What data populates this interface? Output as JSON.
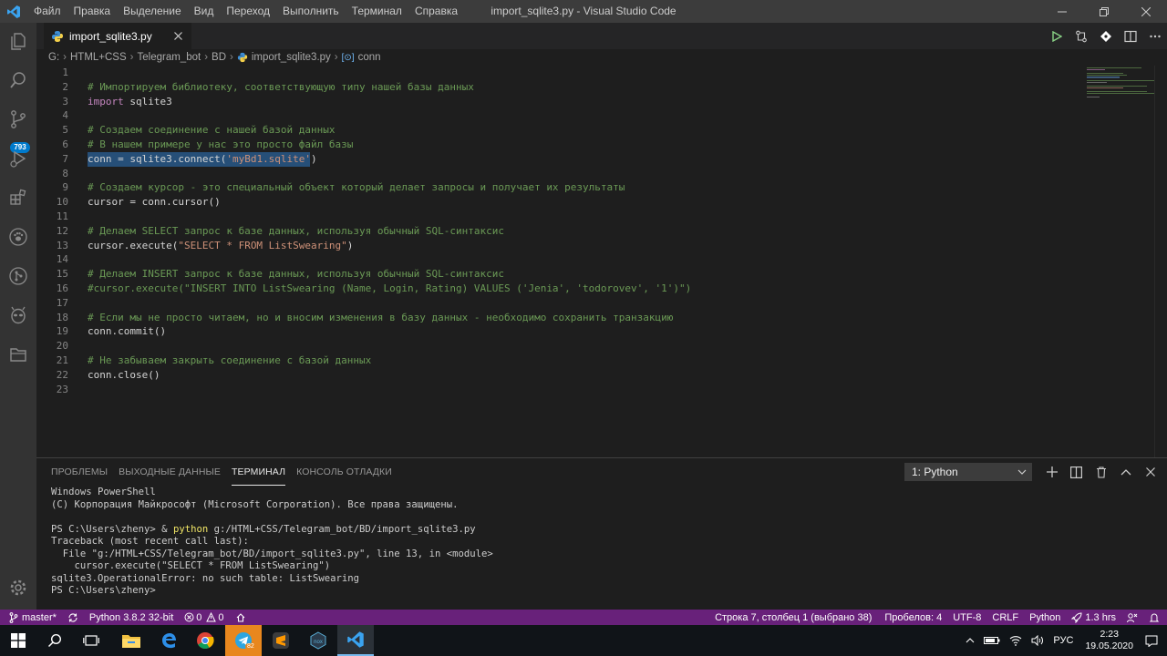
{
  "titlebar": {
    "menu": [
      "Файл",
      "Правка",
      "Выделение",
      "Вид",
      "Переход",
      "Выполнить",
      "Терминал",
      "Справка"
    ],
    "window_title": "import_sqlite3.py - Visual Studio Code"
  },
  "activitybar": {
    "scm_badge": "793"
  },
  "tab": {
    "label": "import_sqlite3.py"
  },
  "breadcrumb": {
    "items": [
      "G:",
      "HTML+CSS",
      "Telegram_bot",
      "BD",
      "import_sqlite3.py",
      "conn"
    ]
  },
  "editor": {
    "lines": [
      {
        "n": "1",
        "parts": []
      },
      {
        "n": "2",
        "parts": [
          {
            "t": "# Импортируем библиотеку, соответствующую типу нашей базы данных",
            "c": "c-comment"
          }
        ]
      },
      {
        "n": "3",
        "parts": [
          {
            "t": "import",
            "c": "c-kw"
          },
          {
            "t": " sqlite3",
            "c": "c-plain"
          }
        ]
      },
      {
        "n": "4",
        "parts": []
      },
      {
        "n": "5",
        "parts": [
          {
            "t": "# Создаем соединение с нашей базой данных",
            "c": "c-comment"
          }
        ]
      },
      {
        "n": "6",
        "parts": [
          {
            "t": "# В нашем примере у нас это просто файл базы",
            "c": "c-comment"
          }
        ]
      },
      {
        "n": "7",
        "parts": [
          {
            "t": "conn = sqlite3.connect(",
            "c": "c-plain"
          },
          {
            "t": "'myBd1.sqlite'",
            "c": "c-str"
          },
          {
            "t": ")",
            "c": "c-plain"
          }
        ]
      },
      {
        "n": "8",
        "parts": []
      },
      {
        "n": "9",
        "parts": [
          {
            "t": "# Создаем курсор - это специальный объект который делает запросы и получает их результаты",
            "c": "c-comment"
          }
        ]
      },
      {
        "n": "10",
        "parts": [
          {
            "t": "cursor = conn.cursor()",
            "c": "c-plain"
          }
        ]
      },
      {
        "n": "11",
        "parts": []
      },
      {
        "n": "12",
        "parts": [
          {
            "t": "# Делаем SELECT запрос к базе данных, используя обычный SQL-синтаксис",
            "c": "c-comment"
          }
        ]
      },
      {
        "n": "13",
        "parts": [
          {
            "t": "cursor.execute(",
            "c": "c-plain"
          },
          {
            "t": "\"SELECT * FROM ListSwearing\"",
            "c": "c-str"
          },
          {
            "t": ")",
            "c": "c-plain"
          }
        ]
      },
      {
        "n": "14",
        "parts": []
      },
      {
        "n": "15",
        "parts": [
          {
            "t": "# Делаем INSERT запрос к базе данных, используя обычный SQL-синтаксис",
            "c": "c-comment"
          }
        ]
      },
      {
        "n": "16",
        "parts": [
          {
            "t": "#cursor.execute(\"INSERT INTO ListSwearing (Name, Login, Rating) VALUES ('Jenia', 'todorovev', '1')\")",
            "c": "c-comment"
          }
        ]
      },
      {
        "n": "17",
        "parts": []
      },
      {
        "n": "18",
        "parts": [
          {
            "t": "# Если мы не просто читаем, но и вносим изменения в базу данных - необходимо сохранить транзакцию",
            "c": "c-comment"
          }
        ]
      },
      {
        "n": "19",
        "parts": [
          {
            "t": "conn.commit()",
            "c": "c-plain"
          }
        ]
      },
      {
        "n": "20",
        "parts": []
      },
      {
        "n": "21",
        "parts": [
          {
            "t": "# Не забываем закрыть соединение с базой данных",
            "c": "c-comment"
          }
        ]
      },
      {
        "n": "22",
        "parts": [
          {
            "t": "conn.close()",
            "c": "c-plain"
          }
        ]
      },
      {
        "n": "23",
        "parts": []
      }
    ]
  },
  "panel": {
    "tabs": [
      "ПРОБЛЕМЫ",
      "ВЫХОДНЫЕ ДАННЫЕ",
      "ТЕРМИНАЛ",
      "КОНСОЛЬ ОТЛАДКИ"
    ],
    "terminal_select": "1: Python",
    "terminal_lines": [
      [
        {
          "t": "Windows PowerShell",
          "c": ""
        }
      ],
      [
        {
          "t": "(C) Корпорация Майкрософт (Microsoft Corporation). Все права защищены.",
          "c": ""
        }
      ],
      [],
      [
        {
          "t": "PS C:\\Users\\zheny> & ",
          "c": ""
        },
        {
          "t": "python",
          "c": "t-yellow"
        },
        {
          "t": " g:/HTML+CSS/Telegram_bot/BD/import_sqlite3.py",
          "c": ""
        }
      ],
      [
        {
          "t": "Traceback (most recent call last):",
          "c": ""
        }
      ],
      [
        {
          "t": "  File \"g:/HTML+CSS/Telegram_bot/BD/import_sqlite3.py\", line 13, in <module>",
          "c": ""
        }
      ],
      [
        {
          "t": "    cursor.execute(\"SELECT * FROM ListSwearing\")",
          "c": ""
        }
      ],
      [
        {
          "t": "sqlite3.OperationalError: no such table: ListSwearing",
          "c": ""
        }
      ],
      [
        {
          "t": "PS C:\\Users\\zheny>",
          "c": ""
        }
      ]
    ]
  },
  "statusbar": {
    "branch": "master*",
    "interpreter": "Python 3.8.2 32-bit",
    "errors": "0",
    "warnings": "0",
    "cursor_pos": "Строка 7, столбец 1 (выбрано 38)",
    "spaces": "Пробелов: 4",
    "encoding": "UTF-8",
    "eol": "CRLF",
    "language": "Python",
    "time_tracked": "1.3 hrs"
  },
  "taskbar": {
    "telegram_badge": "82",
    "lang": "РУС",
    "time": "2:23",
    "date": "19.05.2020"
  },
  "colors": {
    "statusbar": "#68217a",
    "accent": "#007acc",
    "selection": "#264f78"
  }
}
